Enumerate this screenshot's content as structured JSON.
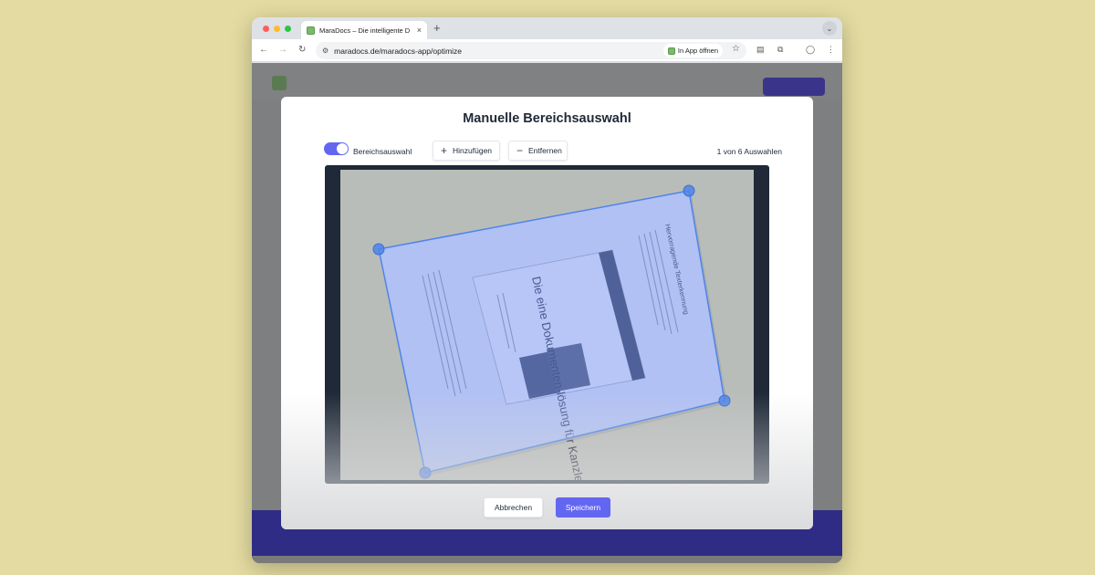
{
  "browser": {
    "tab_title": "MaraDocs – Die intelligente D",
    "tab_close": "×",
    "new_tab": "+",
    "tab_menu": "⌄",
    "url_host": "maradocs.de",
    "url_path": "/maradocs-app/optimize",
    "open_in_app": "In App öffnen",
    "icons": [
      "back-arrow-icon",
      "forward-arrow-icon",
      "reload-icon",
      "site-settings-icon",
      "star-icon",
      "extensions-icon",
      "profile-icon",
      "menu-icon"
    ]
  },
  "modal": {
    "title": "Manuelle Bereichsauswahl",
    "toggle_label": "Bereichsauswahl",
    "toggle_on": true,
    "add_label": "Hinzufügen",
    "add_symbol": "+",
    "remove_label": "Entfernen",
    "remove_symbol": "−",
    "counter": "1 von 6 Auswahlen",
    "cancel_label": "Abbrechen",
    "save_label": "Speichern"
  },
  "document": {
    "main_heading": "Die eine Dokumenten-lösung für Kanzleien",
    "side_heading": "Hervorragende Texterkennung"
  },
  "colors": {
    "accent": "#6366f1",
    "selection_fill": "#9db0f5",
    "handle": "#4f84e8",
    "canvas_bg": "#1f2937",
    "page_background": "#e3dba1"
  }
}
